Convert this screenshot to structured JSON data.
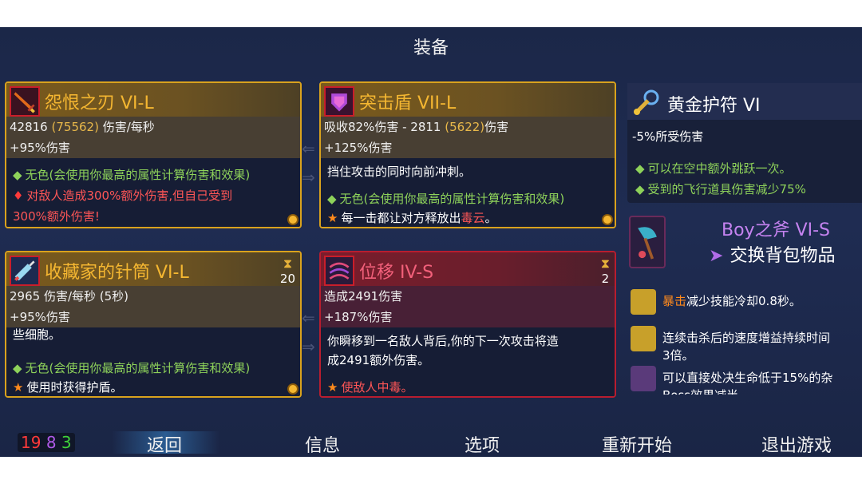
{
  "title": "装备",
  "cards": {
    "c1": {
      "title": "怨恨之刃 VI-L",
      "dps": "42816",
      "dps_hl": "(75562)",
      "dps_unit": "伤害/每秒",
      "bonus": "+95%伤害",
      "b1": "无色(会使用你最高的属性计算伤害和效果)",
      "b2a": "对敌人造成300%额外伤害,但自己受到",
      "b2b": "300%额外伤害!"
    },
    "c2": {
      "title": "突击盾 VII-L",
      "line1a": "吸收82%伤害 - 2811",
      "line1_hl": "(5622)",
      "line1b": "伤害",
      "bonus": "+125%伤害",
      "desc": "挡住攻击的同时向前冲刺。",
      "b1": "无色(会使用你最高的属性计算伤害和效果)",
      "b2a": "每一击都让对方释放出",
      "b2b": "毒云",
      "b2c": "。"
    },
    "c3": {
      "title": "收藏家的针筒 VI-L",
      "timer": "20",
      "line1": "2965 伤害/每秒 (5秒)",
      "bonus": "+95%伤害",
      "desc": "些细胞。",
      "b1": "无色(会使用你最高的属性计算伤害和效果)",
      "b2": "使用时获得护盾。"
    },
    "c4": {
      "title": "位移 IV-S",
      "timer": "2",
      "line1": "造成2491伤害",
      "bonus": "+187%伤害",
      "desc1": "你瞬移到一名敌人背后,你的下一次攻击将造",
      "desc2": "成2491额外伤害。",
      "b2": "使敌人中毒。"
    }
  },
  "amulet": {
    "title": "黄金护符 VI",
    "line": "-5%所受伤害",
    "b1": "可以在空中额外跳跃一次。",
    "b2": "受到的飞行道具伤害减少75%"
  },
  "boy": {
    "title": "Boy之斧 VI-S",
    "swap": "交换背包物品"
  },
  "mutations": {
    "m1a": "暴击",
    "m1b": "减少技能冷却0.8秒。",
    "m2a": "连续击杀后的速度增益持续时间",
    "m2b": "3倍。",
    "m3a": "可以直接处决生命低于15%的杂",
    "m3b": "Boss效果减半"
  },
  "cells": {
    "red": "19",
    "purple": "8",
    "green": "3"
  },
  "menu": {
    "back": "返回",
    "info": "信息",
    "options": "选项",
    "restart": "重新开始",
    "quit": "退出游戏"
  },
  "colors": {
    "gold_border": "#d9a21d",
    "red_border": "#b81d2f",
    "green_text": "#8ed25a",
    "background": "#1b2748"
  },
  "icons": [
    "sword-icon",
    "shield-icon",
    "syringe-icon",
    "teleport-icon",
    "amulet-icon",
    "axe-icon",
    "hourglass-icon",
    "arrow-left-icon"
  ]
}
